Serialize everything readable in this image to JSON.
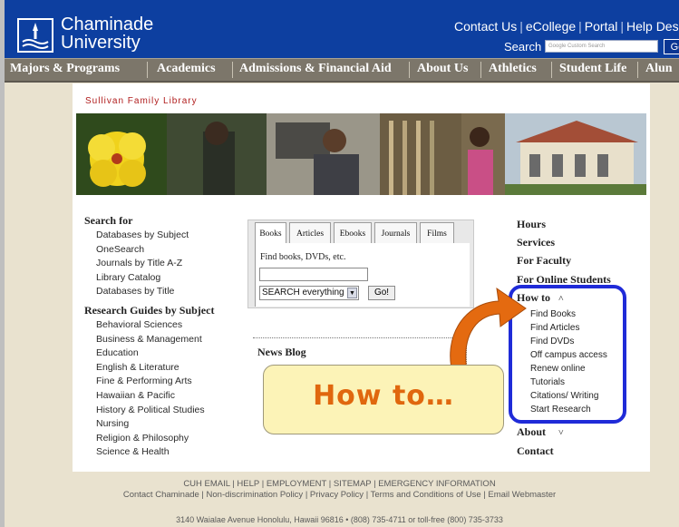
{
  "header": {
    "brand_line1": "Chaminade",
    "brand_line2": "University",
    "top_links": [
      "Contact Us",
      "eCollege",
      "Portal",
      "Help Des"
    ],
    "search_label": "Search",
    "search_placeholder": "Google Custom Search",
    "go_label": "Go"
  },
  "nav": {
    "items": [
      "Majors & Programs",
      "Academics",
      "Admissions & Financial Aid",
      "About Us",
      "Athletics",
      "Student Life",
      "Alun"
    ]
  },
  "library": {
    "title": "Sullivan Family Library"
  },
  "left": {
    "search_for_heading": "Search for",
    "search_for_links": [
      "Databases by Subject",
      "OneSearch",
      "Journals by Title A-Z",
      "Library Catalog",
      "Databases by Title"
    ],
    "guides_heading": "Research Guides by Subject",
    "guides_links": [
      "Behavioral Sciences",
      "Business & Management",
      "Education",
      "English & Literature",
      "Fine & Performing Arts",
      "Hawaiian & Pacific",
      "History & Political Studies",
      "Nursing",
      "Religion & Philosophy",
      "Science & Health"
    ]
  },
  "widget": {
    "tabs": [
      "Books",
      "Articles",
      "Ebooks",
      "Journals",
      "Films"
    ],
    "find_label": "Find books, DVDs, etc.",
    "select_value": "SEARCH everything",
    "go_label": "Go!"
  },
  "news": {
    "title": "News Blog"
  },
  "right": {
    "items": [
      "Hours",
      "Services",
      "For Faculty",
      "For Online Students"
    ],
    "howto_heading": "How to",
    "howto_links": [
      "Find Books",
      "Find Articles",
      "Find DVDs",
      "Off campus access",
      "Renew online",
      "Tutorials",
      "Citations/ Writing",
      "Start Research"
    ],
    "about": "About",
    "contact": "Contact"
  },
  "callout": {
    "text": "How to…"
  },
  "footer": {
    "line1": "CUH EMAIL | HELP | EMPLOYMENT | SITEMAP | EMERGENCY INFORMATION",
    "line2": "Contact Chaminade | Non-discrimination Policy | Privacy Policy | Terms and Conditions of Use | Email Webmaster",
    "address": "3140 Waialae Avenue Honolulu, Hawaii 96816 • (808) 735-4711 or toll-free (800) 735-3733"
  },
  "colors": {
    "header_blue": "#0d3fa0",
    "nav_gray": "#7c766a",
    "library_title_red": "#b01c1c",
    "highlight_blue": "#1f2bd8",
    "callout_orange": "#e0670e"
  }
}
